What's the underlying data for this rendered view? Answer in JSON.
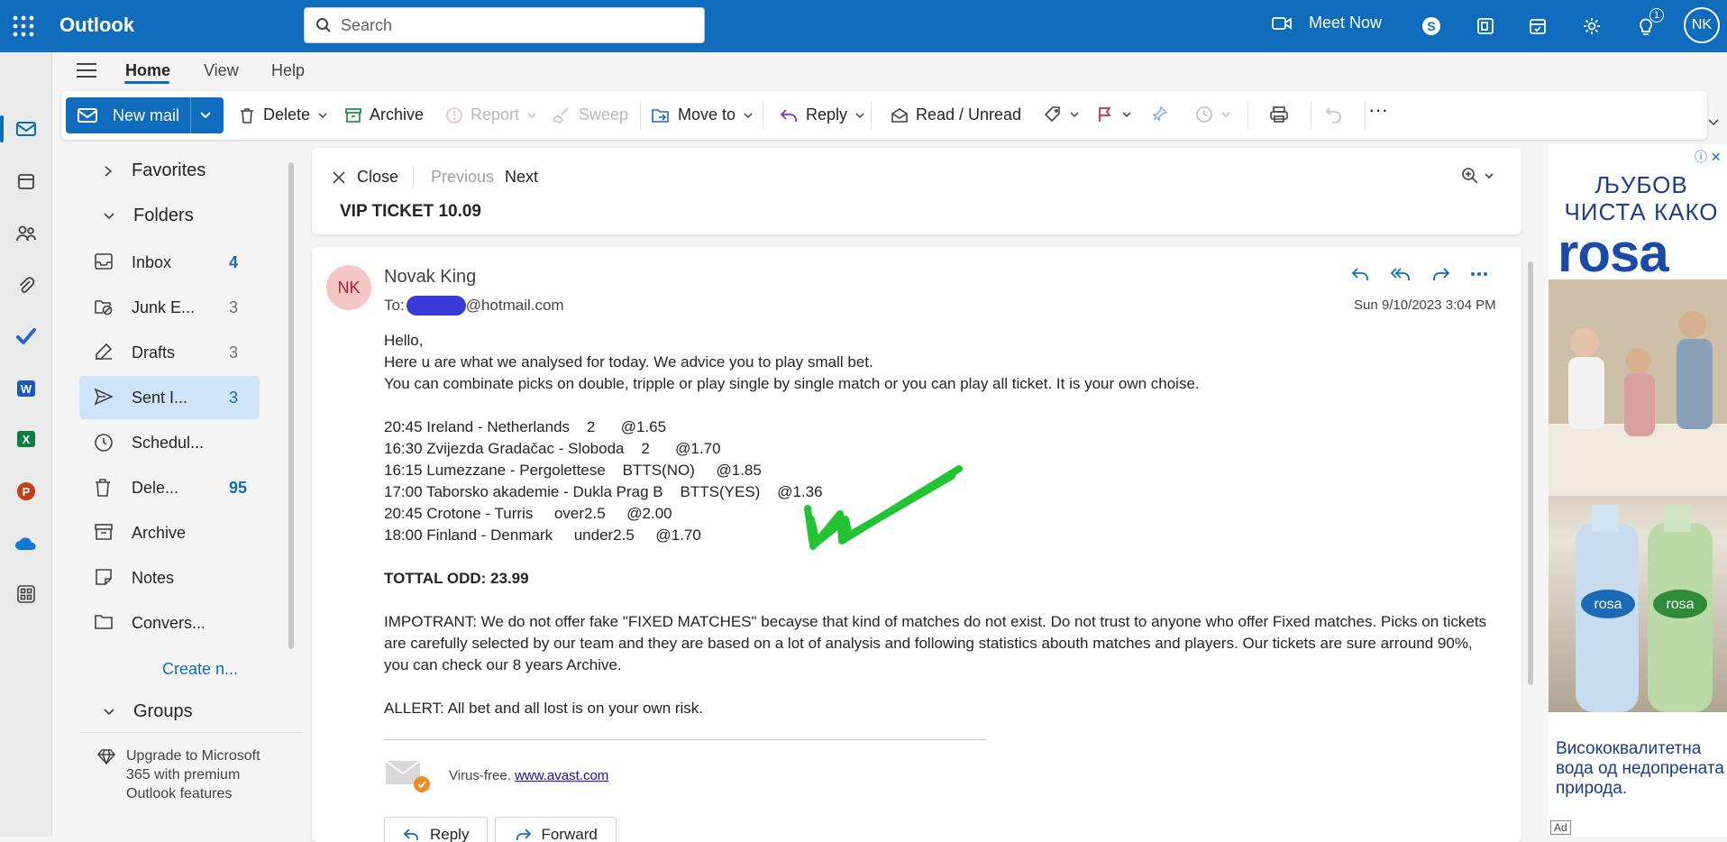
{
  "app": {
    "title": "Outlook"
  },
  "search": {
    "placeholder": "Search"
  },
  "topbar": {
    "meet_now": "Meet Now",
    "avatar_initials": "NK",
    "notif_count": "1"
  },
  "tabs": [
    {
      "label": "Home"
    },
    {
      "label": "View"
    },
    {
      "label": "Help"
    }
  ],
  "ribbon": {
    "new_mail": "New mail",
    "delete": "Delete",
    "archive": "Archive",
    "report": "Report",
    "sweep": "Sweep",
    "move_to": "Move to",
    "reply": "Reply",
    "read_unread": "Read / Unread",
    "more": "···"
  },
  "folders": {
    "favorites": "Favorites",
    "folders": "Folders",
    "items": [
      {
        "name": "Inbox",
        "count": "4"
      },
      {
        "name": "Junk E...",
        "count": "3"
      },
      {
        "name": "Drafts",
        "count": "3"
      },
      {
        "name": "Sent I...",
        "count": "3"
      },
      {
        "name": "Schedul...",
        "count": ""
      },
      {
        "name": "Dele...",
        "count": "95"
      },
      {
        "name": "Archive",
        "count": ""
      },
      {
        "name": "Notes",
        "count": ""
      },
      {
        "name": "Convers...",
        "count": ""
      }
    ],
    "create_new": "Create n...",
    "groups": "Groups",
    "upgrade": "Upgrade to Microsoft 365 with premium Outlook features"
  },
  "reading": {
    "close": "Close",
    "previous": "Previous",
    "next": "Next",
    "subject": "VIP TICKET 10.09"
  },
  "message": {
    "avatar": "NK",
    "sender": "Novak King",
    "to_prefix": "To:",
    "to_domain": "@hotmail.com",
    "date": "Sun 9/10/2023 3:04 PM",
    "greeting": "Hello,",
    "line1": "Here u are what we analysed for today. We advice you to play small bet.",
    "line2": "You can combinate picks on double, tripple or play single by single match or you can play all ticket. It is your own choise.",
    "picks": [
      "20:45 Ireland - Netherlands    2      @1.65",
      "16:30 Zvijezda Gradačac - Sloboda    2      @1.70",
      "16:15 Lumezzane - Pergolettese    BTTS(NO)     @1.85",
      "17:00 Taborsko akademie - Dukla Prag B    BTTS(YES)    @1.36",
      "20:45 Crotone - Turris     over2.5     @2.00",
      "18:00 Finland - Denmark     under2.5     @1.70"
    ],
    "total": "TOTTAL ODD: 23.99",
    "important": "IMPOTRANT: We do not offer fake \"FIXED MATCHES\" becayse that kind of matches do not exist. Do not trust to anyone who offer Fixed matches. Picks on tickets are carefully selected by our team and they are based on a lot of analysis and following statistics abouth matches and players. Our tickets are sure arround 90%, you can check our 8 years Archive.",
    "allert": "ALLERT: All bet and all lost is on your own risk.",
    "virus_free": "Virus-free.",
    "avast_link": "www.avast.com",
    "reply_btn": "Reply",
    "forward_btn": "Forward"
  },
  "ad": {
    "headline": "ЉУБОВ ЧИСТА КАКО",
    "logo": "rosa",
    "tagline": "Висококвалитетна вода од недопрената природа.",
    "ad_label": "Ad"
  },
  "colors": {
    "brand": "#0f6cbd",
    "selected": "#cfe4fa",
    "check": "#22c433"
  }
}
